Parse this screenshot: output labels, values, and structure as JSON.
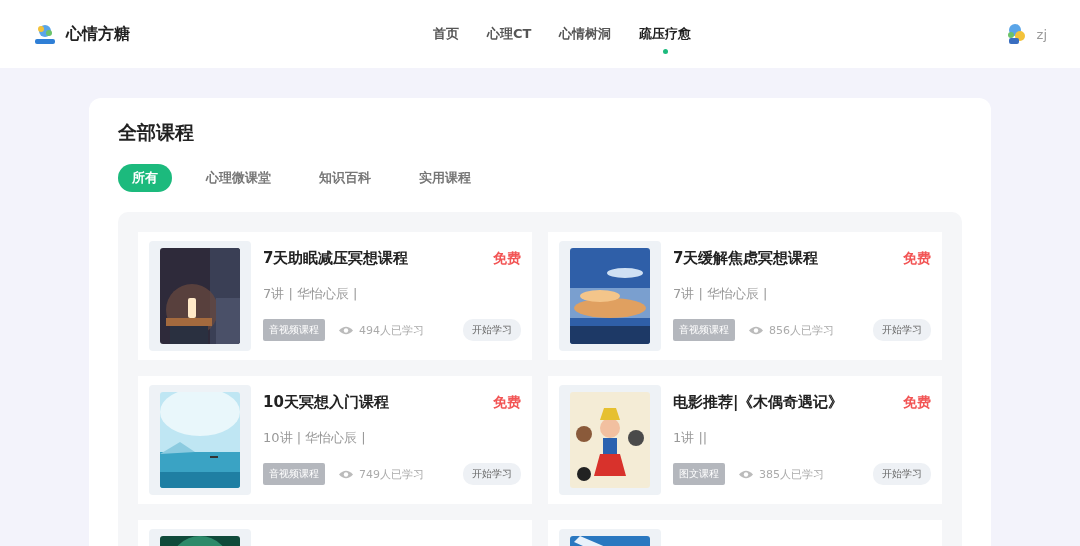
{
  "header": {
    "brand": "心情方糖",
    "nav": [
      {
        "label": "首页",
        "selected": false
      },
      {
        "label": "心理CT",
        "selected": false
      },
      {
        "label": "心情树洞",
        "selected": false
      },
      {
        "label": "疏压疗愈",
        "selected": true
      }
    ],
    "user": "zj"
  },
  "courses": {
    "title": "全部课程",
    "tabs": [
      {
        "label": "所有",
        "selected": true
      },
      {
        "label": "心理微课堂",
        "selected": false
      },
      {
        "label": "知识百科",
        "selected": false
      },
      {
        "label": "实用课程",
        "selected": false
      }
    ],
    "items": [
      {
        "kind": "picture",
        "title": "7天助眠减压冥想课程",
        "price": "免费",
        "meta": "7讲 | 华怡心辰 |",
        "type": "音视频课程",
        "learners": "494人已学习",
        "action": "开始学习"
      },
      {
        "kind": "picture",
        "title": "7天缓解焦虑冥想课程",
        "price": "免费",
        "meta": "7讲 | 华怡心辰 |",
        "type": "音视频课程",
        "learners": "856人已学习",
        "action": "开始学习"
      },
      {
        "kind": "picture",
        "title": "10天冥想入门课程",
        "price": "免费",
        "meta": "10讲 | 华怡心辰 |",
        "type": "音视频课程",
        "learners": "749人已学习",
        "action": "开始学习"
      },
      {
        "kind": "picture",
        "title": "电影推荐|《木偶奇遇记》",
        "price": "免费",
        "meta": "1讲 ||",
        "type": "图文课程",
        "learners": "385人已学习",
        "action": "开始学习"
      },
      {
        "kind": "picture"
      },
      {
        "kind": "picture"
      }
    ]
  }
}
